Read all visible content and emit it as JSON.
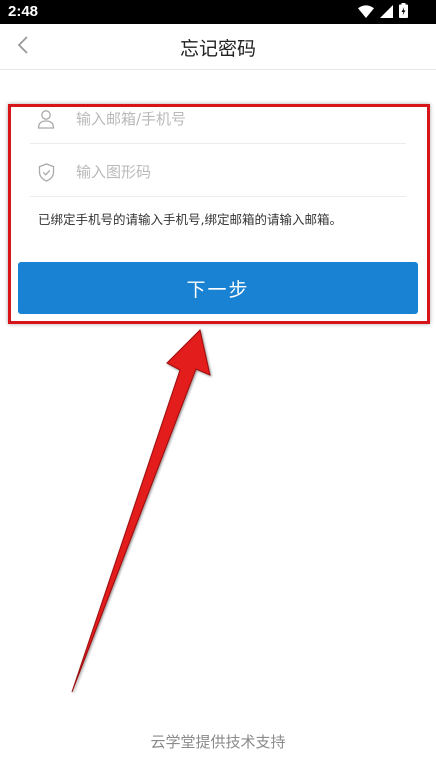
{
  "status_bar": {
    "time": "2:48",
    "icons": [
      "wifi-icon",
      "signal-icon",
      "battery-icon"
    ]
  },
  "nav": {
    "back_icon": "chevron-left-icon",
    "title": "忘记密码"
  },
  "form": {
    "account_icon": "user-icon",
    "account_placeholder": "输入邮箱/手机号",
    "account_value": "",
    "captcha_icon": "shield-check-icon",
    "captcha_placeholder": "输入图形码",
    "captcha_value": "",
    "hint": "已绑定手机号的请输入手机号,绑定邮箱的请输入邮箱。",
    "next_label": "下一步"
  },
  "footer": {
    "text": "云学堂提供技术支持"
  },
  "colors": {
    "primary": "#1a82d2",
    "annotation_red": "#d8141b",
    "placeholder": "#b9b9b9"
  }
}
